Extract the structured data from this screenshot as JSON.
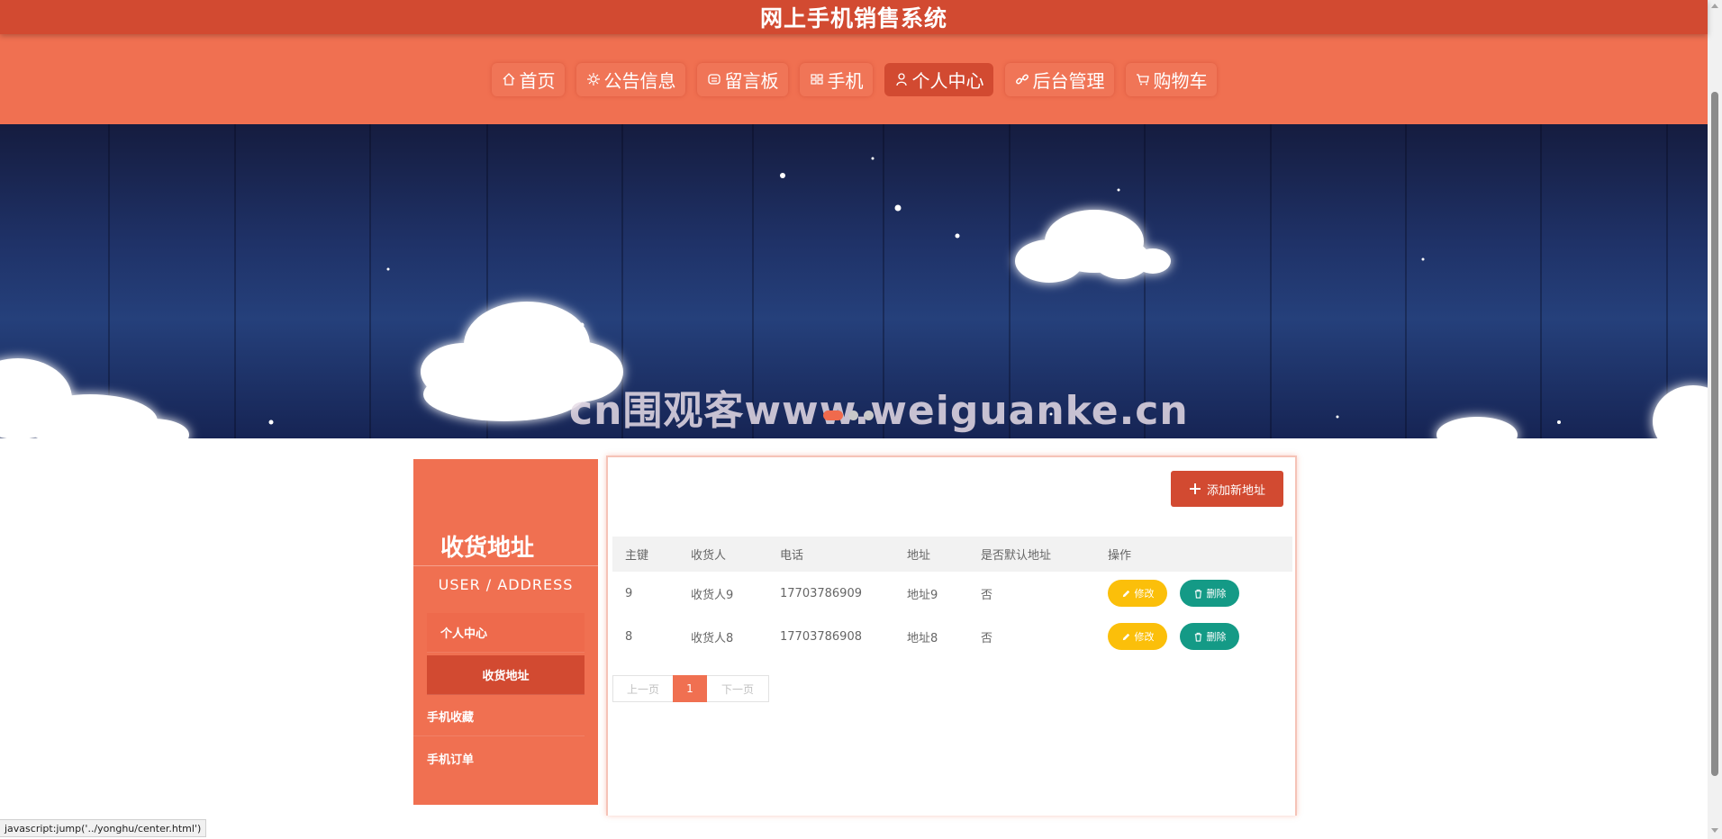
{
  "site": {
    "title": "网上手机销售系统"
  },
  "nav": {
    "items": [
      {
        "label": "首页",
        "icon": "home-icon"
      },
      {
        "label": "公告信息",
        "icon": "gear-icon"
      },
      {
        "label": "留言板",
        "icon": "message-icon"
      },
      {
        "label": "手机",
        "icon": "grid-icon"
      },
      {
        "label": "个人中心",
        "icon": "user-icon",
        "active": true
      },
      {
        "label": "后台管理",
        "icon": "link-icon"
      },
      {
        "label": "购物车",
        "icon": "cart-icon"
      }
    ]
  },
  "banner": {
    "watermark": "cn围观客www.weiguanke.cn",
    "slides": 3,
    "active_slide": 1
  },
  "sidebar": {
    "title": "收货地址",
    "subtitle": "USER / ADDRESS",
    "menu": [
      {
        "label": "个人中心"
      },
      {
        "label": "收货地址",
        "active": true
      },
      {
        "label": "手机收藏"
      },
      {
        "label": "手机订单"
      }
    ]
  },
  "content": {
    "add_button": "添加新地址",
    "columns": [
      "主键",
      "收货人",
      "电话",
      "地址",
      "是否默认地址",
      "操作"
    ],
    "rows": [
      {
        "id": "9",
        "receiver": "收货人9",
        "phone": "17703786909",
        "address": "地址9",
        "is_default": "否"
      },
      {
        "id": "8",
        "receiver": "收货人8",
        "phone": "17703786908",
        "address": "地址8",
        "is_default": "否"
      }
    ],
    "edit_label": "修改",
    "delete_label": "删除"
  },
  "pagination": {
    "prev": "上一页",
    "current": "1",
    "next": "下一页"
  },
  "status_bar": {
    "url": "javascript:jump('../yonghu/center.html')"
  },
  "colors": {
    "title_bar": "#d24a31",
    "nav_bar": "#f07051",
    "edit_button": "#fbbf0a",
    "delete_button": "#149a86"
  }
}
